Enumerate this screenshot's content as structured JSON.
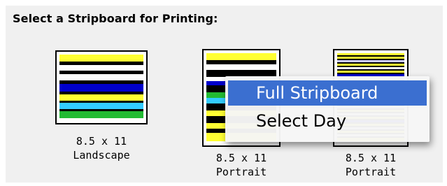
{
  "heading": "Select a Stripboard for Printing:",
  "options": [
    {
      "size": "8.5 x 11",
      "orientation": "Landscape"
    },
    {
      "size": "8.5 x 11",
      "orientation": "Portrait"
    },
    {
      "size": "8.5 x 11",
      "orientation": "Portrait"
    }
  ],
  "context_menu": {
    "items": [
      {
        "label": "Full Stripboard",
        "selected": true
      },
      {
        "label": "Select Day",
        "selected": false
      }
    ]
  },
  "colors": {
    "panel_bg": "#f0f0f0",
    "menu_highlight": "#3b6fd0",
    "strip_yellow": "#ffff33",
    "strip_black": "#000000",
    "strip_white": "#ffffff",
    "strip_blue": "#0000cc",
    "strip_cyan": "#33ccff",
    "strip_green": "#22bb33",
    "strip_lavender": "#ccccff"
  }
}
